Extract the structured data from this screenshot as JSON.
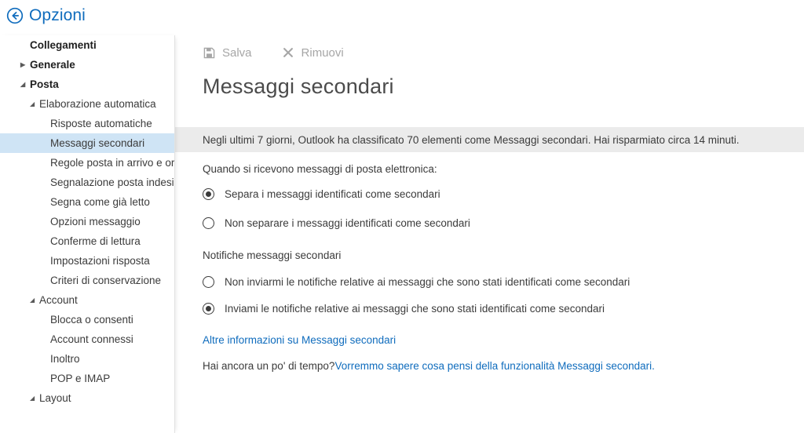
{
  "header": {
    "back_icon": "back-arrow-circle-icon",
    "title": "Opzioni",
    "accent_color": "#0f6cbd"
  },
  "sidebar": {
    "items": [
      {
        "label": "Collegamenti",
        "level": 0,
        "marker": "none",
        "selected": false,
        "bold": true
      },
      {
        "label": "Generale",
        "level": 0,
        "marker": "collapsed",
        "selected": false,
        "bold": true
      },
      {
        "label": "Posta",
        "level": 0,
        "marker": "expanded",
        "selected": false,
        "bold": true
      },
      {
        "label": "Elaborazione automatica",
        "level": 1,
        "marker": "expanded",
        "selected": false,
        "bold": false
      },
      {
        "label": "Risposte automatiche",
        "level": 2,
        "marker": "none",
        "selected": false,
        "bold": false
      },
      {
        "label": "Messaggi secondari",
        "level": 2,
        "marker": "none",
        "selected": true,
        "bold": false
      },
      {
        "label": "Regole posta in arrivo e organizzazione",
        "level": 2,
        "marker": "none",
        "selected": false,
        "bold": false
      },
      {
        "label": "Segnalazione posta indesiderata",
        "level": 2,
        "marker": "none",
        "selected": false,
        "bold": false
      },
      {
        "label": "Segna come già letto",
        "level": 2,
        "marker": "none",
        "selected": false,
        "bold": false
      },
      {
        "label": "Opzioni messaggio",
        "level": 2,
        "marker": "none",
        "selected": false,
        "bold": false
      },
      {
        "label": "Conferme di lettura",
        "level": 2,
        "marker": "none",
        "selected": false,
        "bold": false
      },
      {
        "label": "Impostazioni risposta",
        "level": 2,
        "marker": "none",
        "selected": false,
        "bold": false
      },
      {
        "label": "Criteri di conservazione",
        "level": 2,
        "marker": "none",
        "selected": false,
        "bold": false
      },
      {
        "label": "Account",
        "level": 1,
        "marker": "expanded",
        "selected": false,
        "bold": false
      },
      {
        "label": "Blocca o consenti",
        "level": 2,
        "marker": "none",
        "selected": false,
        "bold": false
      },
      {
        "label": "Account connessi",
        "level": 2,
        "marker": "none",
        "selected": false,
        "bold": false
      },
      {
        "label": "Inoltro",
        "level": 2,
        "marker": "none",
        "selected": false,
        "bold": false
      },
      {
        "label": "POP e IMAP",
        "level": 2,
        "marker": "none",
        "selected": false,
        "bold": false
      },
      {
        "label": "Layout",
        "level": 1,
        "marker": "expanded",
        "selected": false,
        "bold": false
      }
    ],
    "selected_background": "#cfe4f5"
  },
  "toolbar": {
    "save_label": "Salva",
    "save_icon": "save-floppy-icon",
    "remove_label": "Rimuovi",
    "remove_icon": "close-x-icon",
    "disabled_color": "#a6a6a6"
  },
  "main": {
    "title": "Messaggi secondari",
    "banner": {
      "text": "Negli ultimi 7 giorni, Outlook ha classificato 70 elementi come Messaggi secondari. Hai risparmiato circa 14 minuti.",
      "background": "#ebebeb",
      "days": 7,
      "items_classified": 70,
      "minutes_saved": 14
    },
    "group_one": {
      "label": "Quando si ricevono messaggi di posta elettronica:",
      "options": [
        {
          "label": "Separa i messaggi identificati come secondari",
          "selected": true
        },
        {
          "label": "Non separare i messaggi identificati come secondari",
          "selected": false
        }
      ]
    },
    "group_two": {
      "label": "Notifiche messaggi secondari",
      "options": [
        {
          "label": "Non inviarmi le notifiche relative ai messaggi che sono stati identificati come secondari",
          "selected": false
        },
        {
          "label": "Inviami le notifiche relative ai messaggi che sono stati identificati come secondari",
          "selected": true
        }
      ]
    },
    "more_info_link": "Altre informazioni su Messaggi secondari",
    "feedback": {
      "prompt": "Hai ancora un po' di tempo?",
      "link": "Vorremmo sapere cosa pensi della funzionalità Messaggi secondari."
    }
  }
}
